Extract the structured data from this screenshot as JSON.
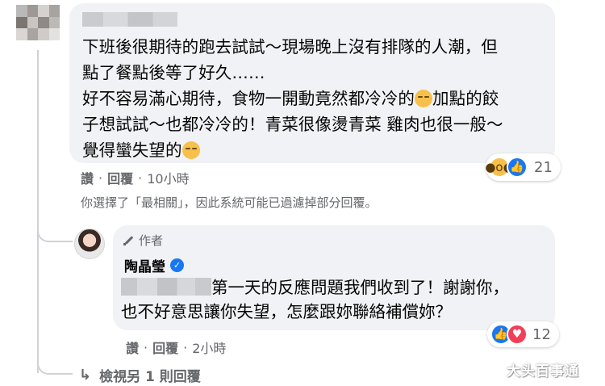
{
  "comment": {
    "author_obscured": true,
    "text_lines": [
      "下班後很期待的跑去試試～現場晚上沒有排隊的人潮，但",
      "點了餐點後等了好久……",
      "好不容易滿心期待，食物一開動竟然都冷冷的",
      "加點的餃",
      "子想試試～也都冷冷的！青菜很像燙青菜 雞肉也很一般～",
      "覺得蠻失望的"
    ],
    "emoji": "disappointed-emoji",
    "reactions": {
      "icons": [
        "wow-icon",
        "like-icon"
      ],
      "count": "21"
    },
    "actions": {
      "like": "讚",
      "reply": "回覆",
      "time": "10小時"
    }
  },
  "filter_note": "你選擇了「最相關」，因此系統可能已過濾掉部分回覆。",
  "reply": {
    "badge": "作者",
    "author_name": "陶晶瑩",
    "line1": "第一天的反應問題我們收到了！謝謝你，",
    "line2": "也不好意思讓你失望，怎麼跟妳聯絡補償妳？",
    "reactions": {
      "icons": [
        "like-icon",
        "love-icon"
      ],
      "count": "12"
    },
    "actions": {
      "like": "讚",
      "reply": "回覆",
      "time": "2小時"
    }
  },
  "more_replies": "檢視另 1 則回覆",
  "watermark": "大头百事通",
  "colors": {
    "bubble": "#f0f2f5",
    "muted_text": "#65676b",
    "like_blue": "#1877f2",
    "love_red": "#f33e58",
    "wow_yellow": "#f7c04a"
  }
}
